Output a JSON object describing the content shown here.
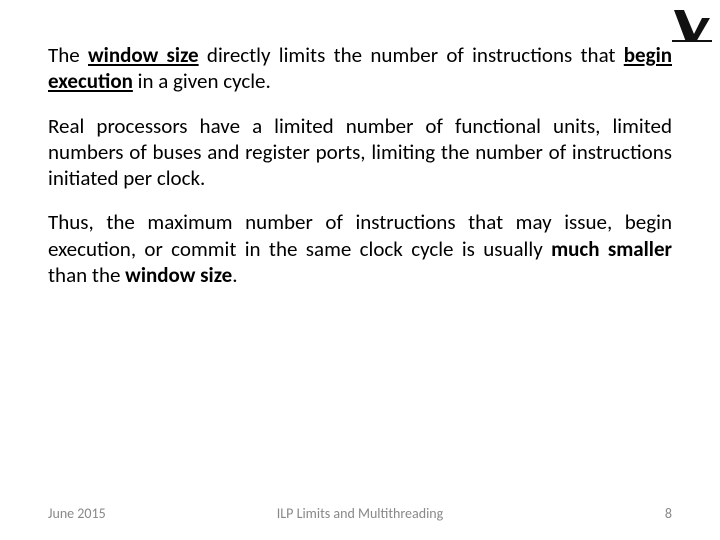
{
  "logo": {
    "name": "institution-logo"
  },
  "p1": {
    "t1": "The ",
    "t2": "window size",
    "t3": " directly limits the number of instructions that ",
    "t4": "begin execution",
    "t5": " in a given cycle."
  },
  "p2": "Real processors have a limited number of functional units, limited numbers of buses and register ports, limiting the number of instructions initiated per clock.",
  "p3": {
    "t1": "Thus, the maximum number of instructions that may issue, begin execution, or commit in the same clock cycle is usually ",
    "t2": "much smaller",
    "t3": " than the ",
    "t4": "window size",
    "t5": "."
  },
  "footer": {
    "date": "June 2015",
    "title": "ILP Limits and Multithreading",
    "page": "8"
  }
}
